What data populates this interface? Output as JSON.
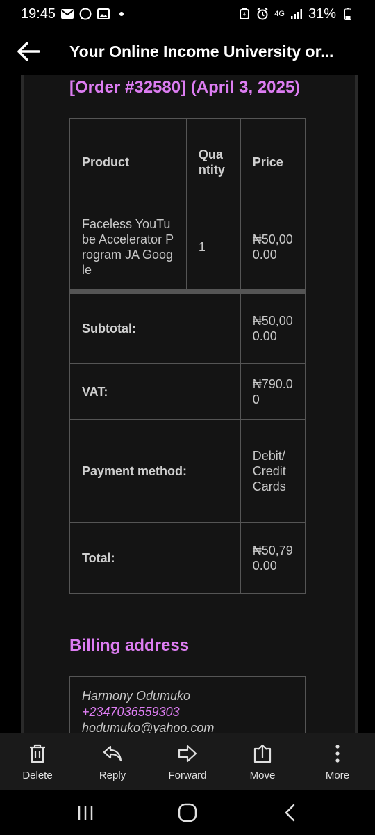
{
  "status_bar": {
    "time": "19:45",
    "network": "4G",
    "battery": "31%",
    "icons": [
      "mail-icon",
      "whatsapp-icon",
      "gallery-icon",
      "dot-icon",
      "battery-saver-icon",
      "alarm-icon",
      "signal-icon",
      "battery-icon"
    ]
  },
  "app_bar": {
    "title": "Your Online Income University or..."
  },
  "email": {
    "order_heading": "[Order #32580] (April 3, 2025)",
    "table": {
      "headers": {
        "product": "Product",
        "quantity": "Quantity",
        "price": "Price"
      },
      "items": [
        {
          "product": "Faceless YouTube Accelerator Program JA Google",
          "quantity": "1",
          "price": "₦50,000.00"
        }
      ],
      "totals": [
        {
          "label": "Subtotal:",
          "value": "₦50,000.00"
        },
        {
          "label": "VAT:",
          "value": "₦790.00"
        },
        {
          "label": "Payment method:",
          "value": "Debit/Credit Cards"
        },
        {
          "label": "Total:",
          "value": "₦50,790.00"
        }
      ]
    },
    "billing_heading": "Billing address",
    "billing": {
      "name": "Harmony Odumuko",
      "phone": "+2347036559303",
      "email": "hodumuko@yahoo.com"
    }
  },
  "actions": [
    {
      "label": "Delete",
      "icon": "trash-icon"
    },
    {
      "label": "Reply",
      "icon": "reply-icon"
    },
    {
      "label": "Forward",
      "icon": "forward-icon"
    },
    {
      "label": "Move",
      "icon": "move-icon"
    },
    {
      "label": "More",
      "icon": "more-icon"
    }
  ],
  "nav": [
    "recents-icon",
    "home-icon",
    "back-icon"
  ],
  "colors": {
    "accent": "#dd7df2",
    "background": "#000000",
    "panel": "#141414"
  }
}
